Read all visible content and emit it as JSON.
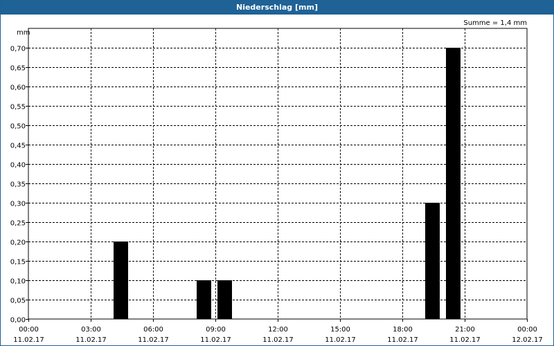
{
  "window": {
    "title": "Niederschlag [mm]"
  },
  "chart_data": {
    "type": "bar",
    "title": "Niederschlag [mm]",
    "ylabel": "mm",
    "annotation": "Summe = 1,4 mm",
    "ylim": [
      0,
      0.75
    ],
    "xlim_hours": [
      0,
      24
    ],
    "y_ticks": [
      "0,00",
      "0,05",
      "0,10",
      "0,15",
      "0,20",
      "0,25",
      "0,30",
      "0,35",
      "0,40",
      "0,45",
      "0,50",
      "0,55",
      "0,60",
      "0,65",
      "0,70"
    ],
    "x_ticks": [
      {
        "time": "00:00",
        "date": "11.02.17"
      },
      {
        "time": "03:00",
        "date": "11.02.17"
      },
      {
        "time": "06:00",
        "date": "11.02.17"
      },
      {
        "time": "09:00",
        "date": "11.02.17"
      },
      {
        "time": "12:00",
        "date": "11.02.17"
      },
      {
        "time": "15:00",
        "date": "11.02.17"
      },
      {
        "time": "18:00",
        "date": "11.02.17"
      },
      {
        "time": "21:00",
        "date": "11.02.17"
      },
      {
        "time": "00:00",
        "date": "12.02.17"
      }
    ],
    "bars": [
      {
        "time": "04:00",
        "value": 0.2
      },
      {
        "time": "08:00",
        "value": 0.1
      },
      {
        "time": "09:00",
        "value": 0.1
      },
      {
        "time": "19:00",
        "value": 0.3
      },
      {
        "time": "20:00",
        "value": 0.7
      }
    ],
    "grid": true,
    "colors": {
      "bar": "#000000",
      "grid": "#000000",
      "titlebar": "#1e6296"
    }
  }
}
